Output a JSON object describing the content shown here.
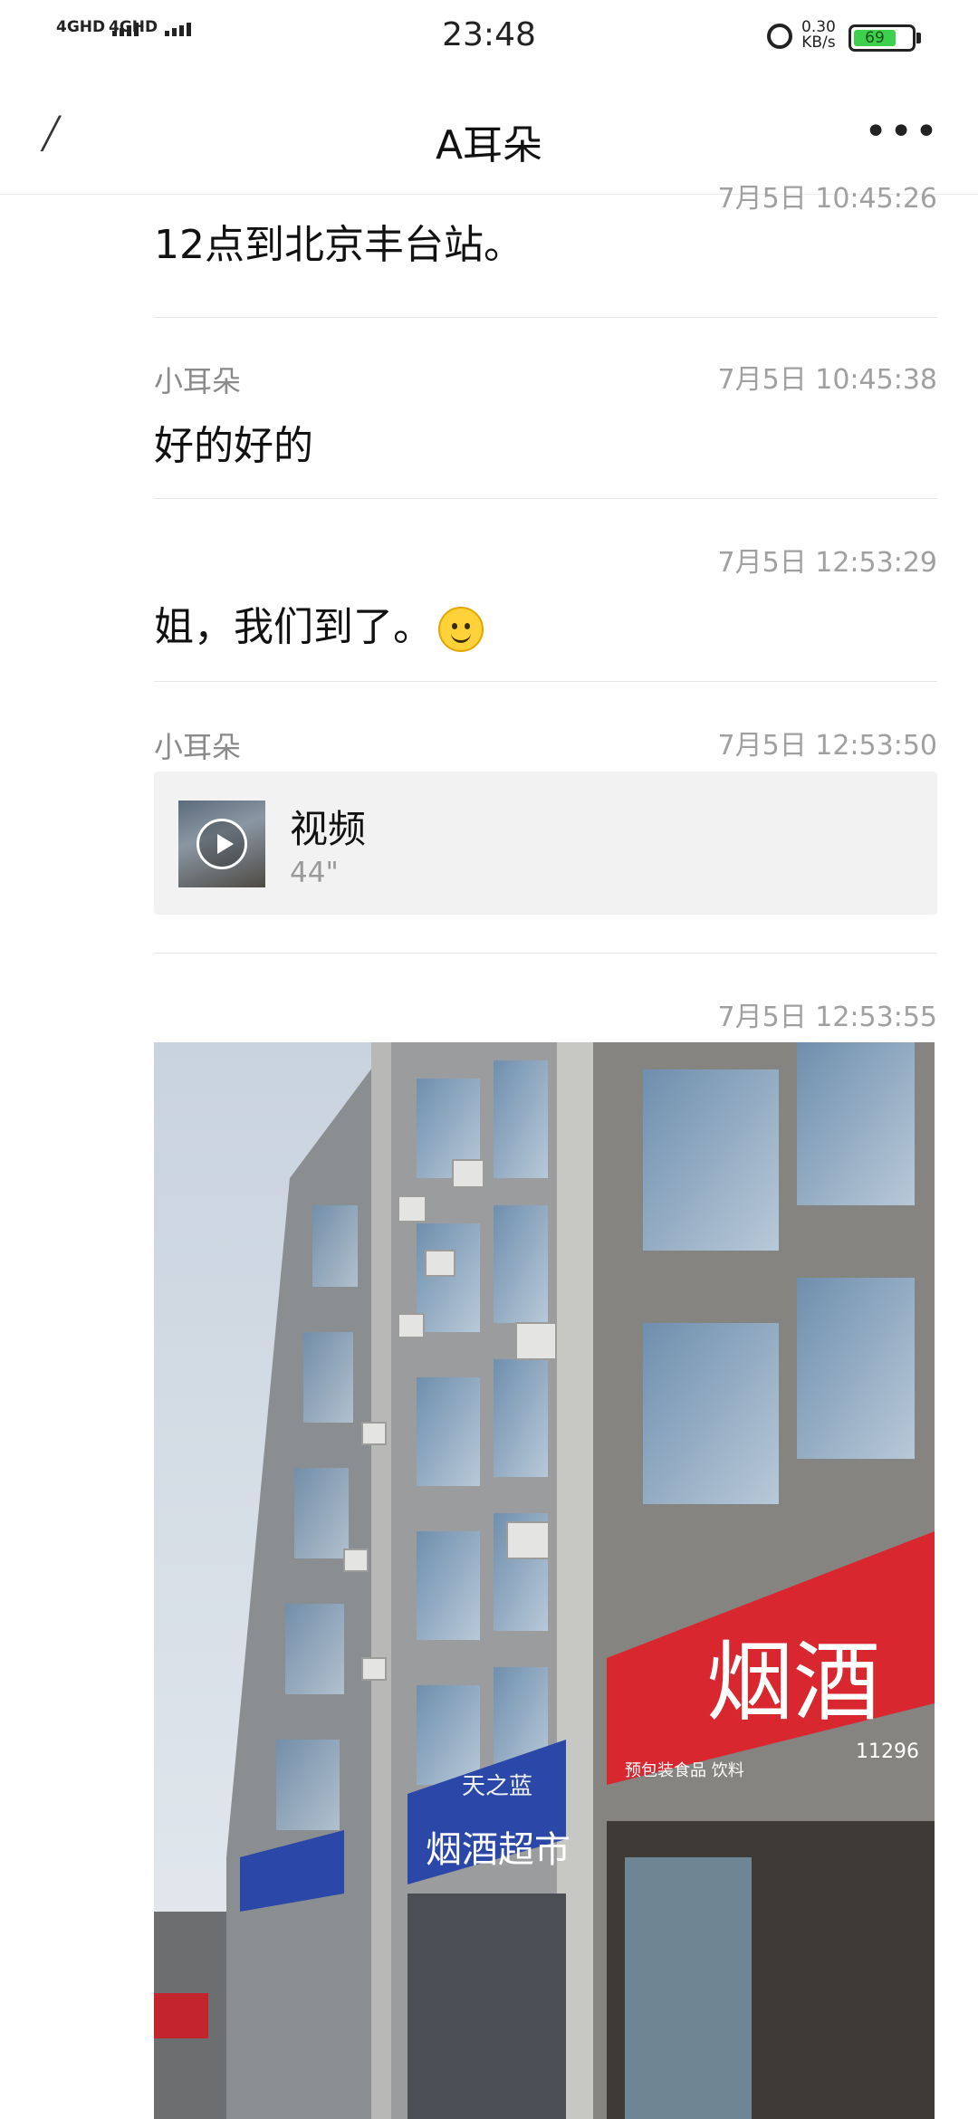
{
  "status_bar": {
    "signal_1": "4GHD",
    "signal_2": "4GHD",
    "time": "23:48",
    "net_speed_value": "0.30",
    "net_speed_unit": "KB/s",
    "battery": "69",
    "icons": [
      "signal-icon",
      "signal-icon",
      "alarm-icon",
      "battery-icon"
    ]
  },
  "nav": {
    "back_icon": "back-arrow-icon",
    "title": "A耳朵",
    "more_icon": "more-icon",
    "more_label": "•••"
  },
  "messages": [
    {
      "sender": "",
      "time": "7月5日 10:45:26",
      "text": "12点到北京丰台站。"
    },
    {
      "sender": "小耳朵",
      "time": "7月5日 10:45:38",
      "text": "好的好的"
    },
    {
      "sender": "",
      "time": "7月5日 12:53:29",
      "text": "姐，我们到了。"
    },
    {
      "sender": "小耳朵",
      "time": "7月5日 12:53:50",
      "video": {
        "title": "视频",
        "duration": "44\""
      }
    },
    {
      "sender": "",
      "time": "7月5日 12:53:55",
      "image": {
        "signs": [
          "烟酒",
          "11296",
          "预包装食品 饮料",
          "烟酒超市",
          "天之蓝"
        ]
      }
    }
  ],
  "colors": {
    "battery_fill": "#3ecf4c",
    "sign_red": "#d8272f",
    "sign_blue": "#2b47a8"
  }
}
